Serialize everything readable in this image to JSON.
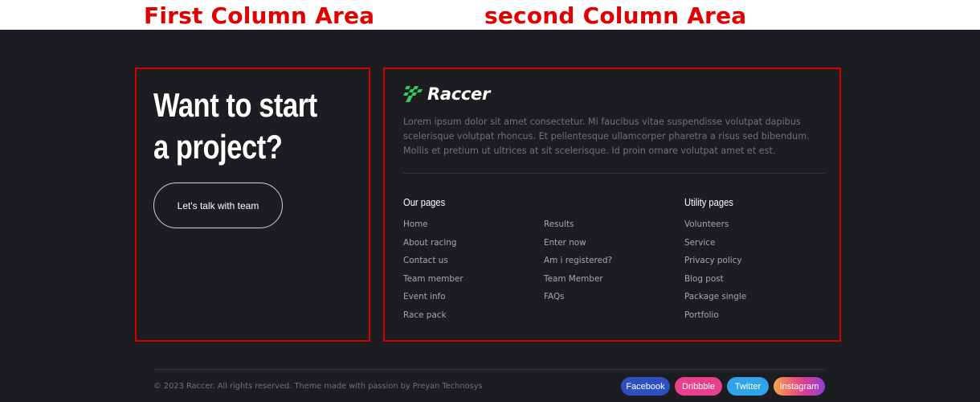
{
  "annotations": {
    "first": "First Column Area",
    "second": "second Column Area"
  },
  "colors": {
    "annotation": "#e00000",
    "footer_bg": "#1c1d21",
    "logo_green": "#2fcc5c"
  },
  "first_column": {
    "headline": "Want to start a project?",
    "cta_label": "Let's talk with team"
  },
  "second_column": {
    "logo_icon": "checkered-flag-icon",
    "logo_text": "Raccer",
    "description": "Lorem ipsum dolor sit amet consectetur. Mi faucibus vitae suspendisse volutpat dapibus scelerisque volutpat rhoncus. Et pellentesque ullamcorper pharetra a risus sed bibendum. Mollis et pretium ut ultrices at sit scelerisque. Id proin ornare volutpat amet et est.",
    "our_pages": {
      "title": "Our pages",
      "links": [
        "Home",
        "About racing",
        "Contact us",
        "Team member",
        "Event info",
        "Race pack"
      ]
    },
    "more_pages": {
      "links": [
        "Results",
        "Enter now",
        "Am i registered?",
        "Team Member",
        "FAQs"
      ]
    },
    "utility_pages": {
      "title": "Utility pages",
      "links": [
        "Volunteers",
        "Service",
        "Privacy policy",
        "Blog post",
        "Package single",
        "Portfolio"
      ]
    }
  },
  "bottom": {
    "copyright": "© 2023 Raccer. All rights reserved. Theme made with passion by Preyan Technosys",
    "socials": [
      "Facebook",
      "Dribbble",
      "Twitter",
      "Instagram"
    ]
  }
}
